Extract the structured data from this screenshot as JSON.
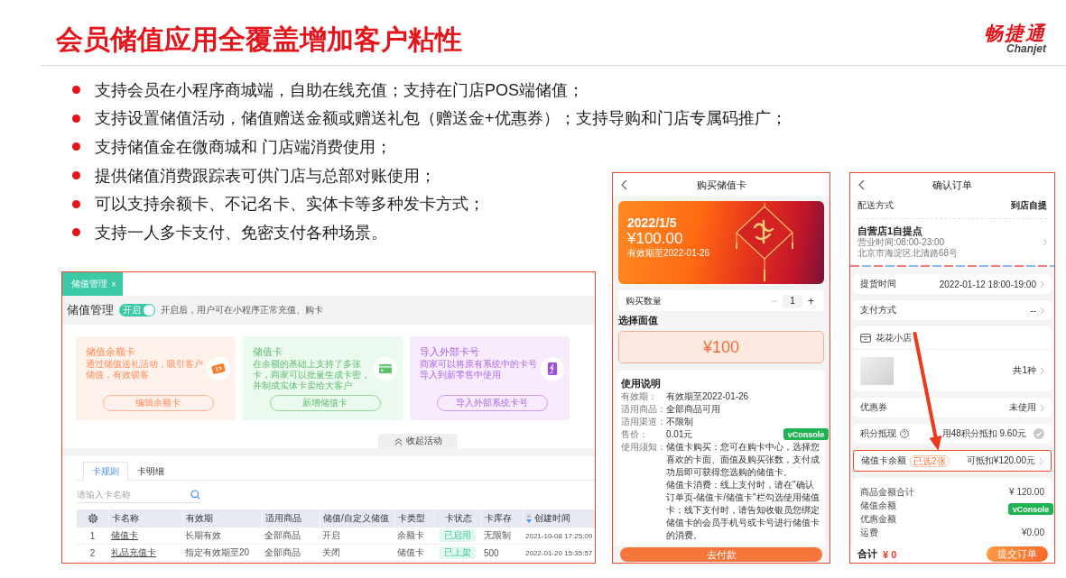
{
  "header": {
    "title": "会员储值应用全覆盖增加客户粘性",
    "logo": {
      "text": "畅捷通",
      "latin": "Chanjet"
    }
  },
  "bullets": [
    "支持会员在小程序商城端，自助在线充值；支持在门店POS端储值；",
    "支持设置储值活动，储值赠送金额或赠送礼包（赠送金+优惠券）；支持导购和门店专属码推广；",
    "支持储值金在微商城和 门店端消费使用；",
    "提供储值消费跟踪表可供门店与总部对账使用；",
    "可以支持余额卡、不记名卡、实体卡等多种发卡方式；",
    "支持一人多卡支付、免密支付各种场景。"
  ],
  "admin": {
    "tab": {
      "label": "储值管理",
      "close": "×"
    },
    "title": "储值管理",
    "toggle": {
      "label": "开启",
      "on": true
    },
    "toggle_hint": "开启后，用户可在小程序正常充值、购卡",
    "cards": [
      {
        "kind": "balance",
        "title": "储值余额卡",
        "description": "通过储值送礼活动，吸引客户储值，有效锁客",
        "button": "编辑余额卡"
      },
      {
        "kind": "card",
        "title": "储值卡",
        "description": "在余额的基础上支持了多张卡，商家可以批量生成卡密，并制成实体卡卖给大客户",
        "button": "新增储值卡"
      },
      {
        "kind": "import",
        "title": "导入外部卡号",
        "description": "商家可以将原有系统中的卡号导入到新零售中使用",
        "button": "导入外部系统卡号"
      }
    ],
    "collapse": "收起活动",
    "tabs": [
      {
        "label": "卡规则",
        "selected": true
      },
      {
        "label": "卡明细",
        "selected": false
      }
    ],
    "search": {
      "placeholder": "请输入卡名称"
    },
    "table": {
      "columns": [
        {
          "label": "卡名称",
          "kind": "link",
          "sortable": false
        },
        {
          "label": "有效期",
          "kind": "text",
          "sortable": false
        },
        {
          "label": "适用商品",
          "kind": "text",
          "sortable": false
        },
        {
          "label": "储值/自定义储值",
          "kind": "text",
          "sortable": false
        },
        {
          "label": "卡类型",
          "kind": "text",
          "sortable": false
        },
        {
          "label": "卡状态",
          "kind": "status",
          "sortable": false
        },
        {
          "label": "卡库存",
          "kind": "text",
          "sortable": false
        },
        {
          "label": "创建时间",
          "kind": "datetime",
          "sortable": true
        }
      ],
      "rows": [
        {
          "no": "1",
          "cells": [
            "储值卡",
            "长期有效",
            "全部商品",
            "开启",
            "余额卡",
            "已启用",
            "无限制",
            "2021-10-08 17:25:09"
          ]
        },
        {
          "no": "2",
          "cells": [
            "礼品充值卡",
            "指定有效期至20",
            "全部商品",
            "关闭",
            "储值卡",
            "已上架",
            "500",
            "2022-01-20 15:35:57"
          ]
        }
      ]
    }
  },
  "purchase_phone": {
    "title": "购买储值卡",
    "banner": {
      "date": "2022/1/5",
      "amount": "¥100.00",
      "expiry": "有效期至2022-01-26"
    },
    "quantity": {
      "label": "购买数量",
      "minus": "−",
      "minus_disabled": true,
      "value": "1",
      "plus": "+"
    },
    "denomination_label": "选择面值",
    "denominations": [
      {
        "label": "¥100",
        "selected": true
      }
    ],
    "usage": {
      "title": "使用说明",
      "items": [
        {
          "label": "有效期：",
          "value": "有效期至2022-01-26"
        },
        {
          "label": "适用商品：",
          "value": "全部商品可用"
        },
        {
          "label": "适用渠道：",
          "value": "不限制"
        },
        {
          "label": "售价：",
          "value": "0.01元"
        },
        {
          "label": "使用须知：",
          "paragraphs": [
            "储值卡购买：您可在购卡中心，选择您喜欢的卡面、面值及购买张数，支付成功后即可获得您选购的储值卡。",
            "储值卡消费：线上支付时，请在\"确认订单页-储值卡/储值卡\"栏勾选使用储值卡；线下支付时，请告知收银员您绑定储值卡的会员手机号或卡号进行储值卡的消费。"
          ]
        }
      ]
    },
    "debug_button": "vConsole",
    "pay_button": "去付款"
  },
  "order_phone": {
    "title": "确认订单",
    "delivery": {
      "label": "配送方式",
      "value": "到店自提"
    },
    "pickup": {
      "name": "自营店1自提点",
      "hours": "营业时间:08:00-23:00",
      "address": "北京市海淀区北清路68号"
    },
    "sections": [
      {
        "kind": "row",
        "label": "提货时间",
        "value": "2022-01-12 18:00-19:00"
      },
      {
        "kind": "row",
        "label": "支付方式",
        "value": "--"
      },
      {
        "kind": "store",
        "name": "花花小店",
        "count": "共1种"
      },
      {
        "kind": "row",
        "label": "优惠券",
        "value": "未使用"
      },
      {
        "kind": "points",
        "label": "积分抵现",
        "value": "用48积分抵扣 9.60元",
        "checked": false
      },
      {
        "kind": "stored_card",
        "label": "储值卡余额",
        "badge": "已选2张",
        "value": "可抵扣¥120.00元",
        "highlighted": true
      }
    ],
    "summary": [
      {
        "label": "商品金额合计",
        "value": "¥ 120.00"
      },
      {
        "label": "储值余额"
      },
      {
        "label": "优惠金额"
      },
      {
        "label": "运费",
        "value": "¥0.00"
      }
    ],
    "total": {
      "label": "合计",
      "value": "¥ 0"
    },
    "submit": "提交订单",
    "debug_button": "vConsole"
  }
}
